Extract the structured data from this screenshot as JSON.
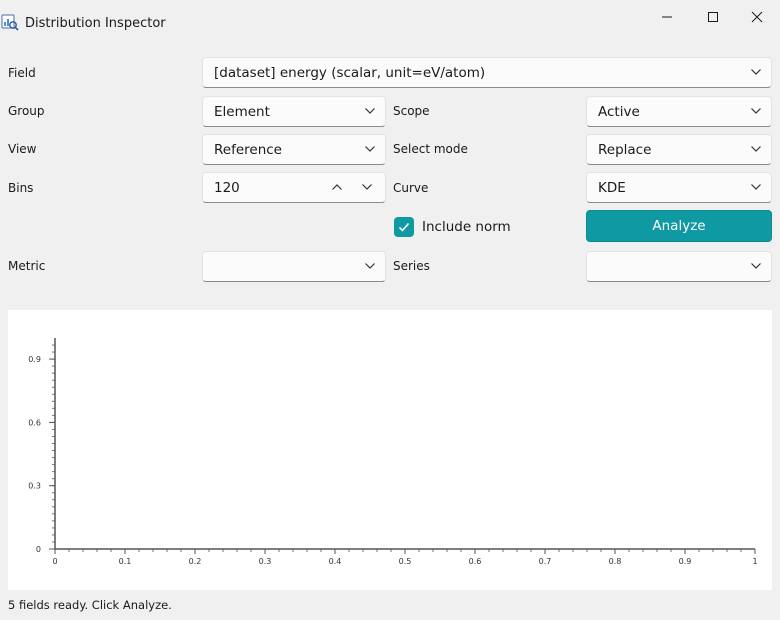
{
  "window": {
    "title": "Distribution Inspector",
    "minimize_icon": "minimize-icon",
    "maximize_icon": "maximize-icon",
    "close_icon": "close-icon"
  },
  "form": {
    "field": {
      "label": "Field",
      "value": "[dataset] energy (scalar, unit=eV/atom)"
    },
    "group": {
      "label": "Group",
      "value": "Element"
    },
    "scope": {
      "label": "Scope",
      "value": "Active"
    },
    "view": {
      "label": "View",
      "value": "Reference"
    },
    "select_mode": {
      "label": "Select mode",
      "value": "Replace"
    },
    "bins": {
      "label": "Bins",
      "value": "120"
    },
    "curve": {
      "label": "Curve",
      "value": "KDE"
    },
    "include_norm": {
      "label": "Include norm",
      "checked": true
    },
    "analyze": {
      "label": "Analyze"
    },
    "metric": {
      "label": "Metric",
      "value": ""
    },
    "series": {
      "label": "Series",
      "value": ""
    }
  },
  "colors": {
    "accent": "#0f9aa3",
    "background": "#f0f0f0",
    "plot_background": "#ffffff"
  },
  "chart_data": {
    "type": "line",
    "title": "",
    "xlabel": "",
    "ylabel": "",
    "series": [],
    "xlim": [
      0,
      1
    ],
    "ylim": [
      0,
      1
    ],
    "x_ticks": [
      "0",
      "0.1",
      "0.2",
      "0.3",
      "0.4",
      "0.5",
      "0.6",
      "0.7",
      "0.8",
      "0.9",
      "1"
    ],
    "y_ticks": [
      "0",
      "0.3",
      "0.6",
      "0.9"
    ],
    "grid": false
  },
  "status": "5 fields ready. Click Analyze."
}
